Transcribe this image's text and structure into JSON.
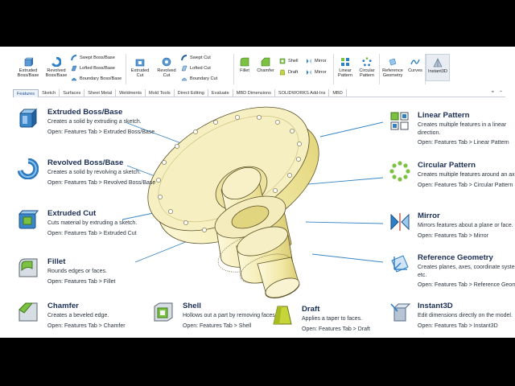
{
  "ribbon": {
    "extruded_boss": "Extruded\nBoss/Base",
    "revolved_boss": "Revolved\nBoss/Base",
    "swept_boss": "Swept Boss/Base",
    "lofted_boss": "Lofted Boss/Base",
    "boundary_boss": "Boundary Boss/Base",
    "extruded_cut": "Extruded\nCut",
    "revolved_cut": "Revolved\nCut",
    "swept_cut": "Swept Cut",
    "lofted_cut": "Lofted Cut",
    "boundary_cut": "Boundary Cut",
    "fillet": "Fillet",
    "chamfer": "Chamfer",
    "shell": "Shell",
    "draft": "Draft",
    "mirror1": "Mirror",
    "mirror2": "Mirror",
    "linear_pattern": "Linear\nPattern",
    "circular_pattern": "Circular\nPattern",
    "reference_geometry": "Reference\nGeometry",
    "curves": "Curves",
    "instant3d": "Instant3D"
  },
  "tabs": [
    "Features",
    "Sketch",
    "Surfaces",
    "Sheet Metal",
    "Weldments",
    "Mold Tools",
    "Direct Editing",
    "Evaluate",
    "MBD Dimensions",
    "SOLIDWORKS Add-Ins",
    "MBD"
  ],
  "active_tab": "Features",
  "features_left": [
    {
      "title": "Extruded Boss/Base",
      "desc": "Creates a solid by extruding a sketch.",
      "open": "Open: Features Tab > Extruded Boss/Base"
    },
    {
      "title": "Revolved Boss/Base",
      "desc": "Creates a solid by revolving a sketch.",
      "open": "Open: Features Tab > Revolved Boss/Base"
    },
    {
      "title": "Extruded Cut",
      "desc": "Cuts material by extruding a sketch.",
      "open": "Open: Features Tab > Extruded Cut"
    },
    {
      "title": "Fillet",
      "desc": "Rounds edges or faces.",
      "open": "Open: Features Tab > Fillet"
    }
  ],
  "features_right": [
    {
      "title": "Linear Pattern",
      "desc": "Creates multiple features in a linear direction.",
      "open": "Open: Features Tab > Linear Pattern"
    },
    {
      "title": "Circular Pattern",
      "desc": "Creates multiple features around an axis.",
      "open": "Open: Features Tab > Circular Pattern"
    },
    {
      "title": "Mirror",
      "desc": "Mirrors features about a plane or face.",
      "open": "Open: Features Tab > Mirror"
    },
    {
      "title": "Reference Geometry",
      "desc": "Creates planes, axes, coordinate systems, etc.",
      "open": "Open: Features Tab > Reference Geometry"
    }
  ],
  "features_bottom": [
    {
      "title": "Chamfer",
      "desc": "Creates a beveled edge.",
      "open": "Open: Features Tab > Chamfer"
    },
    {
      "title": "Shell",
      "desc": "Hollows out a part by removing faces.",
      "open": "Open: Features Tab > Shell"
    },
    {
      "title": "Draft",
      "desc": "Applies a taper to faces.",
      "open": "Open: Features Tab > Draft"
    },
    {
      "title": "Instant3D",
      "desc": "Edit dimensions directly on the model.",
      "open": "Open: Features Tab > Instant3D"
    }
  ],
  "colors": {
    "accent": "#1a2d55",
    "part": "#f3ecb6",
    "icon_blue": "#2f7fc4",
    "icon_green": "#7cc142"
  }
}
